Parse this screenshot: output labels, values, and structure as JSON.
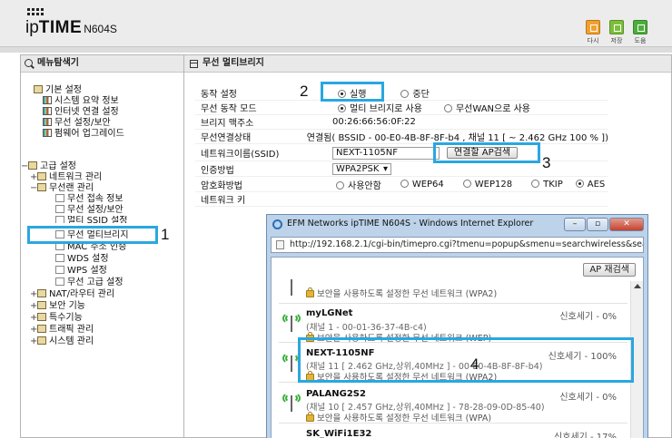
{
  "header": {
    "logo": {
      "ip": "ip",
      "time": "TIME",
      "model": "N604S"
    },
    "buttons": [
      {
        "label": "다시",
        "icon": "refresh-icon",
        "color": "#f2a12e"
      },
      {
        "label": "저장",
        "icon": "save-icon",
        "color": "#7cbf3a"
      },
      {
        "label": "도움",
        "icon": "help-icon",
        "color": "#4cae3c"
      }
    ]
  },
  "menu": {
    "title": "메뉴탐색기",
    "items": [
      {
        "label": "기본 설정",
        "level": 0
      },
      {
        "label": "시스템 요약 정보",
        "level": 1
      },
      {
        "label": "인터넷 연결 설정",
        "level": 1
      },
      {
        "label": "무선 설정/보안",
        "level": 1
      },
      {
        "label": "펌웨어 업그레이드",
        "level": 1
      },
      {
        "label": "고급 설정",
        "level": 0,
        "expander": "−"
      },
      {
        "label": "네트워크 관리",
        "level": 1,
        "expander": "+"
      },
      {
        "label": "무선랜 관리",
        "level": 1,
        "expander": "−"
      },
      {
        "label": "무선 접속 정보",
        "level": 2
      },
      {
        "label": "무선 설정/보안",
        "level": 2
      },
      {
        "label": "멀티 SSID 설정",
        "level": 2
      },
      {
        "label": "무선 멀티브리지",
        "level": 2
      },
      {
        "label": "MAC 주소 인증",
        "level": 2
      },
      {
        "label": "WDS 설정",
        "level": 2
      },
      {
        "label": "WPS 설정",
        "level": 2
      },
      {
        "label": "무선 고급 설정",
        "level": 2
      },
      {
        "label": "NAT/라우터 관리",
        "level": 1,
        "expander": "+"
      },
      {
        "label": "보안 기능",
        "level": 1,
        "expander": "+"
      },
      {
        "label": "특수기능",
        "level": 1,
        "expander": "+"
      },
      {
        "label": "트래픽 관리",
        "level": 1,
        "expander": "+"
      },
      {
        "label": "시스템 관리",
        "level": 1,
        "expander": "+"
      }
    ]
  },
  "main": {
    "title": "무선 멀티브리지",
    "rows": {
      "mode_label": "동작 설정",
      "mode_run": "실행",
      "mode_stop": "중단",
      "wireless_mode_label": "무선 동작 모드",
      "wireless_mode_multi": "멀티 브리지로 사용",
      "wireless_mode_wan": "무선WAN으로 사용",
      "mac_label": "브리지 맥주소",
      "mac_value": "00:26:66:56:0F:22",
      "status_label": "무선연결상태",
      "status_value": "연결됨( BSSID - 00-E0-4B-8F-8F-b4 , 채널 11 [ ~ 2.462 GHz 100 % ])",
      "ssid_label": "네트워크이름(SSID)",
      "ssid_value": "NEXT-1105NF",
      "ap_search": "연결할 AP검색",
      "auth_label": "인증방법",
      "auth_value": "WPA2PSK",
      "enc_label": "암호화방법",
      "enc_options": [
        "사용안함",
        "WEP64",
        "WEP128",
        "TKIP",
        "AES"
      ],
      "key_label": "네트워크 키"
    }
  },
  "annotations": [
    "1",
    "2",
    "3",
    "4"
  ],
  "popup": {
    "title": "EFM Networks ipTIME N604S - Windows Internet Explorer",
    "url": "http://192.168.2.1/cgi-bin/timepro.cgi?tmenu=popup&smenu=searchwireless&searc",
    "rescan": "AP 재검색",
    "networks": [
      {
        "name": "",
        "detail": "",
        "security": "보안을 사용하도록 설정한 무선 네트워크 (WPA2)",
        "signal": ""
      },
      {
        "name": "myLGNet",
        "detail": "(채널 1 - 00-01-36-37-4B-c4)",
        "security": "보안을 사용하도록 설정한 무선 네트워크 (WEP)",
        "signal": "신호세기 - 0%"
      },
      {
        "name": "NEXT-1105NF",
        "detail": "(채널 11 [ 2.462 GHz,상위,40MHz ] - 00-E0-4B-8F-8F-b4)",
        "security": "보안을 사용하도록 설정한 무선 네트워크 (WPA2)",
        "signal": "신호세기 - 100%"
      },
      {
        "name": "PALANG2S2",
        "detail": "(채널 10 [ 2.457 GHz,상위,40MHz ] - 78-28-09-0D-85-40)",
        "security": "보안을 사용하도록 설정한 무선 네트워크 (WPA)",
        "signal": "신호세기 - 0%"
      },
      {
        "name": "SK_WiFi1E32",
        "detail": "",
        "security": "",
        "signal": "신호세기 - 17%"
      }
    ]
  },
  "colors": {
    "highlight": "#2aa7e0",
    "header_bg": "#ececec",
    "popup_frame": "#bcd3ea"
  }
}
